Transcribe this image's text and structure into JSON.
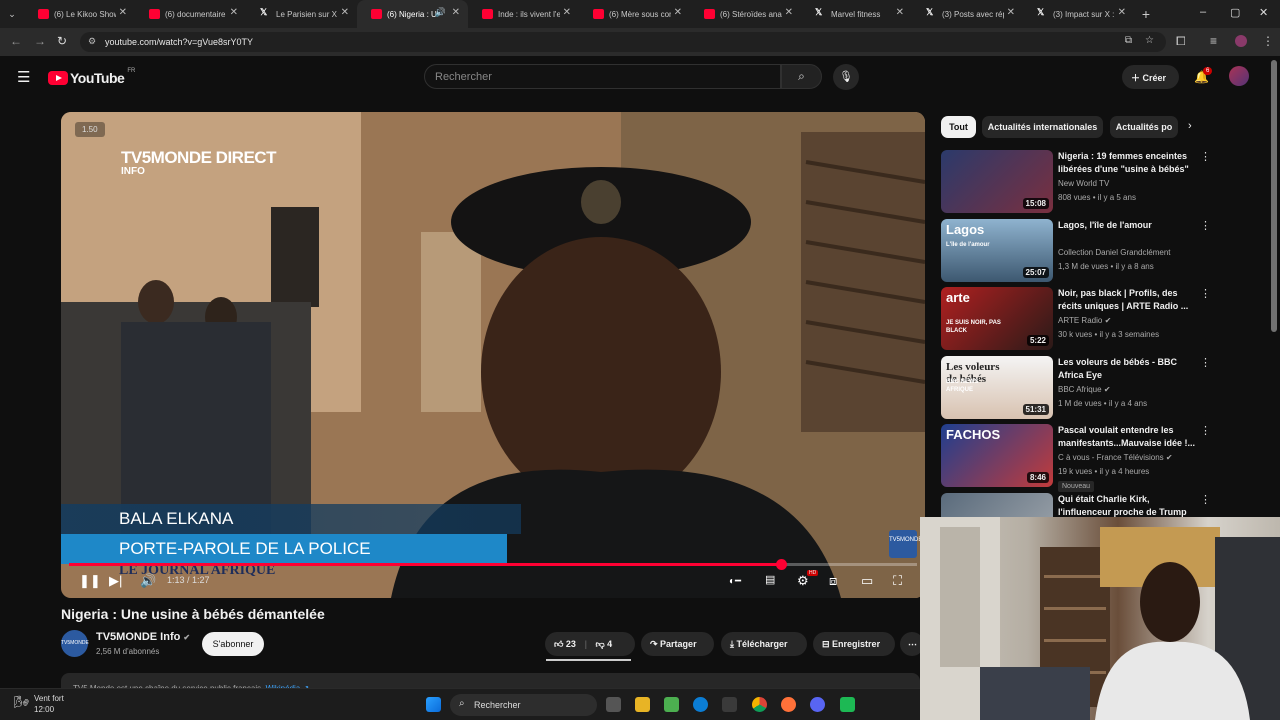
{
  "browser": {
    "tabs": [
      {
        "label": "(6) Le Kikoo Show",
        "icon": "youtube-icon"
      },
      {
        "label": "(6) documentaire",
        "icon": "youtube-icon"
      },
      {
        "label": "Le Parisien sur X :",
        "icon": "x-icon"
      },
      {
        "label": "(6) Nigeria : U",
        "icon": "youtube-icon",
        "active": true
      },
      {
        "label": "Inde : ils vivent l'e",
        "icon": "youtube-icon"
      },
      {
        "label": "(6) Mère sous con",
        "icon": "youtube-icon"
      },
      {
        "label": "(6) Stéroïdes anal",
        "icon": "youtube-icon"
      },
      {
        "label": "Marvel fitness",
        "icon": "x-icon"
      },
      {
        "label": "(3) Posts avec rép",
        "icon": "x-icon"
      },
      {
        "label": "(3) Impact sur X :",
        "icon": "x-icon"
      }
    ],
    "url": "youtube.com/watch?v=gVue8srY0TY"
  },
  "youtube": {
    "logo_text": "YouTube",
    "region": "FR",
    "search_placeholder": "Rechercher",
    "create_label": "Créer",
    "notification_count": "6"
  },
  "player": {
    "speed_label": "1.50",
    "overlay_brand": "TV5MONDE DIRECT",
    "overlay_brand_sub": "INFO",
    "lower_third_name": "BALA ELKANA",
    "lower_third_role": "PORTE-PAROLE DE LA POLICE",
    "lower_third_show": "LE JOURNAL AFRIQUE",
    "corner_badge": "TV5MONDE",
    "time_current": "1:13",
    "time_total": "1:27",
    "time_display": "1:13 / 1:27",
    "progress": 0.84,
    "settings_badge": "HD"
  },
  "video": {
    "title": "Nigeria : Une usine à bébés démantelée",
    "channel": "TV5MONDE Info",
    "channel_logo_text": "TV5MONDE",
    "subscribers": "2,56 M d'abonnés",
    "subscribe_label": "S'abonner",
    "likes": "23",
    "dislikes": "4",
    "share_label": "Partager",
    "download_label": "Télécharger",
    "save_label": "Enregistrer",
    "description_preview": "TV5 Monde est une chaîne du service public français.",
    "description_link": "Wikipédia ↗"
  },
  "chips": [
    "Tout",
    "Actualités internationales",
    "Actualités po"
  ],
  "recommended": [
    {
      "title": "Nigeria : 19 femmes enceintes libérées d'une \"usine à bébés\" ...",
      "channel": "New World TV",
      "meta": "808 vues • il y a 5 ans",
      "duration": "15:08",
      "verified": false
    },
    {
      "title": "Lagos, l'île de l'amour",
      "channel": "Collection Daniel Grandclément",
      "meta": "1,3 M de vues • il y a 8 ans",
      "duration": "25:07",
      "verified": false,
      "thumb_text": "Lagos",
      "thumb_sub": "L'île de l'amour"
    },
    {
      "title": "Noir, pas black | Profils, des récits uniques | ARTE Radio ...",
      "channel": "ARTE Radio",
      "meta": "30 k vues • il y a 3 semaines",
      "duration": "5:22",
      "verified": true,
      "thumb_text": "arte",
      "thumb_sub": "JE SUIS NOIR, PAS BLACK"
    },
    {
      "title": "Les voleurs de bébés - BBC Africa Eye",
      "channel": "BBC Afrique",
      "meta": "1 M de vues • il y a 4 ans",
      "duration": "51:31",
      "verified": true,
      "thumb_text": "Les voleurs de bébés",
      "thumb_sub": "BBC NEWS AFRIQUE"
    },
    {
      "title": "Pascal voulait entendre les manifestants...Mauvaise idée !...",
      "channel": "C à vous - France Télévisions",
      "meta": "19 k vues • il y a 4 heures",
      "duration": "8:46",
      "verified": true,
      "badge": "Nouveau",
      "thumb_text": "FACHOS"
    },
    {
      "title": "Qui était Charlie Kirk, l'influenceur proche de Trump",
      "channel": "",
      "meta": "",
      "duration": "",
      "verified": false
    }
  ],
  "taskbar": {
    "weather_title": "Vent fort",
    "time": "12:00",
    "search_label": "Rechercher"
  },
  "colors": {
    "accent": "#ff0033",
    "background": "#0f0f0f",
    "surface": "#272727"
  }
}
